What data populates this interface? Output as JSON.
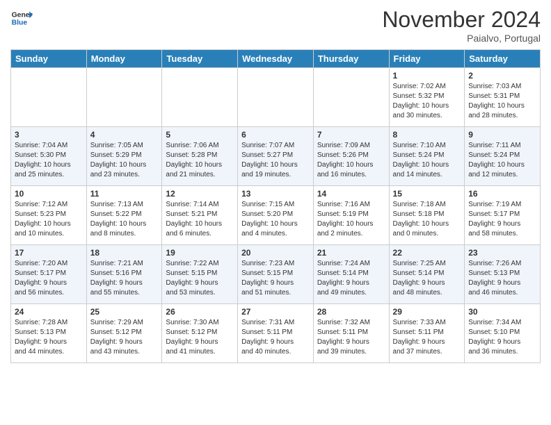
{
  "header": {
    "logo_line1": "General",
    "logo_line2": "Blue",
    "month": "November 2024",
    "location": "Paialvo, Portugal"
  },
  "weekdays": [
    "Sunday",
    "Monday",
    "Tuesday",
    "Wednesday",
    "Thursday",
    "Friday",
    "Saturday"
  ],
  "weeks": [
    [
      {
        "day": "",
        "info": ""
      },
      {
        "day": "",
        "info": ""
      },
      {
        "day": "",
        "info": ""
      },
      {
        "day": "",
        "info": ""
      },
      {
        "day": "",
        "info": ""
      },
      {
        "day": "1",
        "info": "Sunrise: 7:02 AM\nSunset: 5:32 PM\nDaylight: 10 hours\nand 30 minutes."
      },
      {
        "day": "2",
        "info": "Sunrise: 7:03 AM\nSunset: 5:31 PM\nDaylight: 10 hours\nand 28 minutes."
      }
    ],
    [
      {
        "day": "3",
        "info": "Sunrise: 7:04 AM\nSunset: 5:30 PM\nDaylight: 10 hours\nand 25 minutes."
      },
      {
        "day": "4",
        "info": "Sunrise: 7:05 AM\nSunset: 5:29 PM\nDaylight: 10 hours\nand 23 minutes."
      },
      {
        "day": "5",
        "info": "Sunrise: 7:06 AM\nSunset: 5:28 PM\nDaylight: 10 hours\nand 21 minutes."
      },
      {
        "day": "6",
        "info": "Sunrise: 7:07 AM\nSunset: 5:27 PM\nDaylight: 10 hours\nand 19 minutes."
      },
      {
        "day": "7",
        "info": "Sunrise: 7:09 AM\nSunset: 5:26 PM\nDaylight: 10 hours\nand 16 minutes."
      },
      {
        "day": "8",
        "info": "Sunrise: 7:10 AM\nSunset: 5:24 PM\nDaylight: 10 hours\nand 14 minutes."
      },
      {
        "day": "9",
        "info": "Sunrise: 7:11 AM\nSunset: 5:24 PM\nDaylight: 10 hours\nand 12 minutes."
      }
    ],
    [
      {
        "day": "10",
        "info": "Sunrise: 7:12 AM\nSunset: 5:23 PM\nDaylight: 10 hours\nand 10 minutes."
      },
      {
        "day": "11",
        "info": "Sunrise: 7:13 AM\nSunset: 5:22 PM\nDaylight: 10 hours\nand 8 minutes."
      },
      {
        "day": "12",
        "info": "Sunrise: 7:14 AM\nSunset: 5:21 PM\nDaylight: 10 hours\nand 6 minutes."
      },
      {
        "day": "13",
        "info": "Sunrise: 7:15 AM\nSunset: 5:20 PM\nDaylight: 10 hours\nand 4 minutes."
      },
      {
        "day": "14",
        "info": "Sunrise: 7:16 AM\nSunset: 5:19 PM\nDaylight: 10 hours\nand 2 minutes."
      },
      {
        "day": "15",
        "info": "Sunrise: 7:18 AM\nSunset: 5:18 PM\nDaylight: 10 hours\nand 0 minutes."
      },
      {
        "day": "16",
        "info": "Sunrise: 7:19 AM\nSunset: 5:17 PM\nDaylight: 9 hours\nand 58 minutes."
      }
    ],
    [
      {
        "day": "17",
        "info": "Sunrise: 7:20 AM\nSunset: 5:17 PM\nDaylight: 9 hours\nand 56 minutes."
      },
      {
        "day": "18",
        "info": "Sunrise: 7:21 AM\nSunset: 5:16 PM\nDaylight: 9 hours\nand 55 minutes."
      },
      {
        "day": "19",
        "info": "Sunrise: 7:22 AM\nSunset: 5:15 PM\nDaylight: 9 hours\nand 53 minutes."
      },
      {
        "day": "20",
        "info": "Sunrise: 7:23 AM\nSunset: 5:15 PM\nDaylight: 9 hours\nand 51 minutes."
      },
      {
        "day": "21",
        "info": "Sunrise: 7:24 AM\nSunset: 5:14 PM\nDaylight: 9 hours\nand 49 minutes."
      },
      {
        "day": "22",
        "info": "Sunrise: 7:25 AM\nSunset: 5:14 PM\nDaylight: 9 hours\nand 48 minutes."
      },
      {
        "day": "23",
        "info": "Sunrise: 7:26 AM\nSunset: 5:13 PM\nDaylight: 9 hours\nand 46 minutes."
      }
    ],
    [
      {
        "day": "24",
        "info": "Sunrise: 7:28 AM\nSunset: 5:13 PM\nDaylight: 9 hours\nand 44 minutes."
      },
      {
        "day": "25",
        "info": "Sunrise: 7:29 AM\nSunset: 5:12 PM\nDaylight: 9 hours\nand 43 minutes."
      },
      {
        "day": "26",
        "info": "Sunrise: 7:30 AM\nSunset: 5:12 PM\nDaylight: 9 hours\nand 41 minutes."
      },
      {
        "day": "27",
        "info": "Sunrise: 7:31 AM\nSunset: 5:11 PM\nDaylight: 9 hours\nand 40 minutes."
      },
      {
        "day": "28",
        "info": "Sunrise: 7:32 AM\nSunset: 5:11 PM\nDaylight: 9 hours\nand 39 minutes."
      },
      {
        "day": "29",
        "info": "Sunrise: 7:33 AM\nSunset: 5:11 PM\nDaylight: 9 hours\nand 37 minutes."
      },
      {
        "day": "30",
        "info": "Sunrise: 7:34 AM\nSunset: 5:10 PM\nDaylight: 9 hours\nand 36 minutes."
      }
    ]
  ]
}
